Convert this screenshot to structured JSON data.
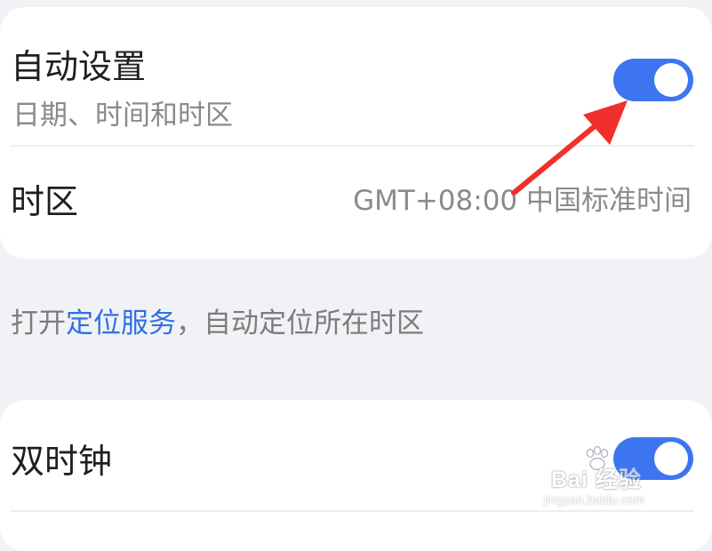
{
  "auto_settings": {
    "title": "自动设置",
    "subtitle": "日期、时间和时区",
    "toggle_on": true
  },
  "timezone": {
    "label": "时区",
    "value": "GMT+08:00 中国标准时间"
  },
  "hint": {
    "prefix": "打开",
    "link": "定位服务",
    "suffix": "，自动定位所在时区"
  },
  "dual_clock": {
    "title": "双时钟",
    "toggle_on": true
  },
  "watermark": {
    "brand": "Bai  经验",
    "url": "jingyan.baidu.com"
  },
  "colors": {
    "accent": "#3d75f0",
    "link": "#2f6fe6",
    "annotation_arrow": "#f0302c",
    "background": "#f1f2f5",
    "card": "#ffffff"
  }
}
